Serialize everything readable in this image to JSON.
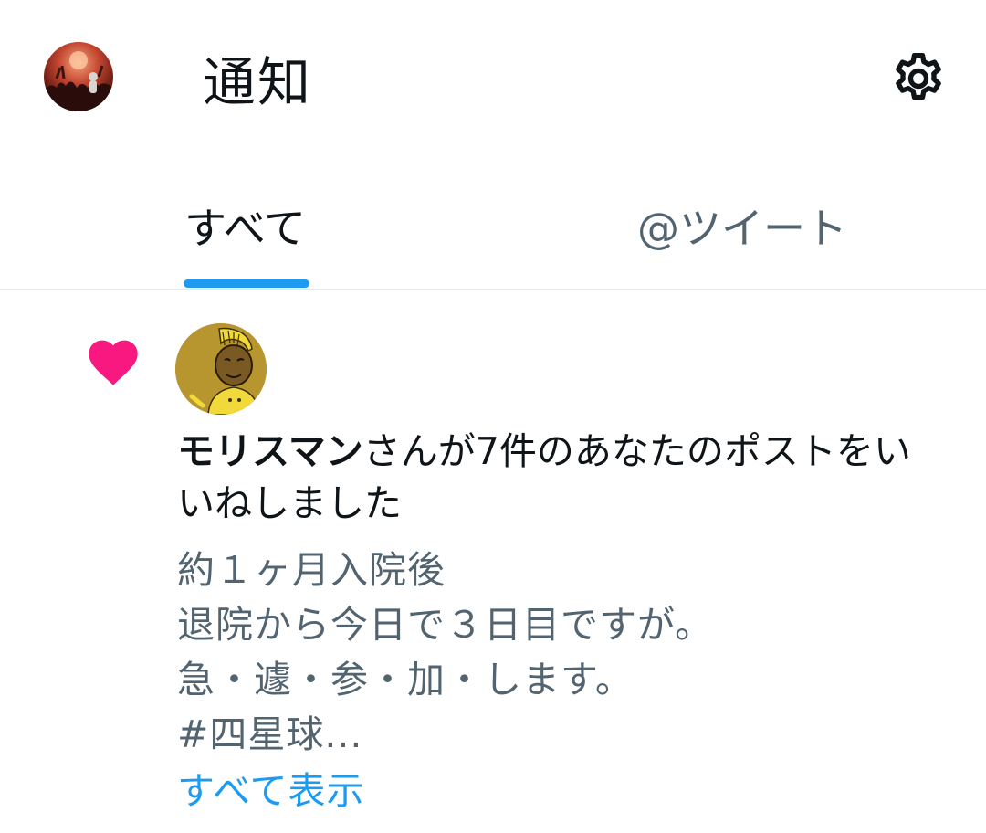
{
  "header": {
    "title": "通知",
    "avatar_icon": "user-avatar-concert-icon",
    "settings_icon": "gear-icon"
  },
  "tabs": [
    {
      "label": "すべて",
      "active": true
    },
    {
      "label": "@ツイート",
      "active": false
    }
  ],
  "notification": {
    "type_icon": "heart-icon",
    "type_color": "#f91880",
    "user_name": "モリスマン",
    "action_text": "さんが7件のあなたのポストをいいねしました",
    "post_lines": [
      "約１ヶ月入院後",
      "退院から今日で３日目ですが。",
      "急・遽・参・加・します。",
      "#四星球..."
    ],
    "show_all_label": "すべて表示"
  },
  "colors": {
    "accent": "#1d9bf0",
    "text_primary": "#0f1419",
    "text_secondary": "#536471",
    "like": "#f91880"
  }
}
